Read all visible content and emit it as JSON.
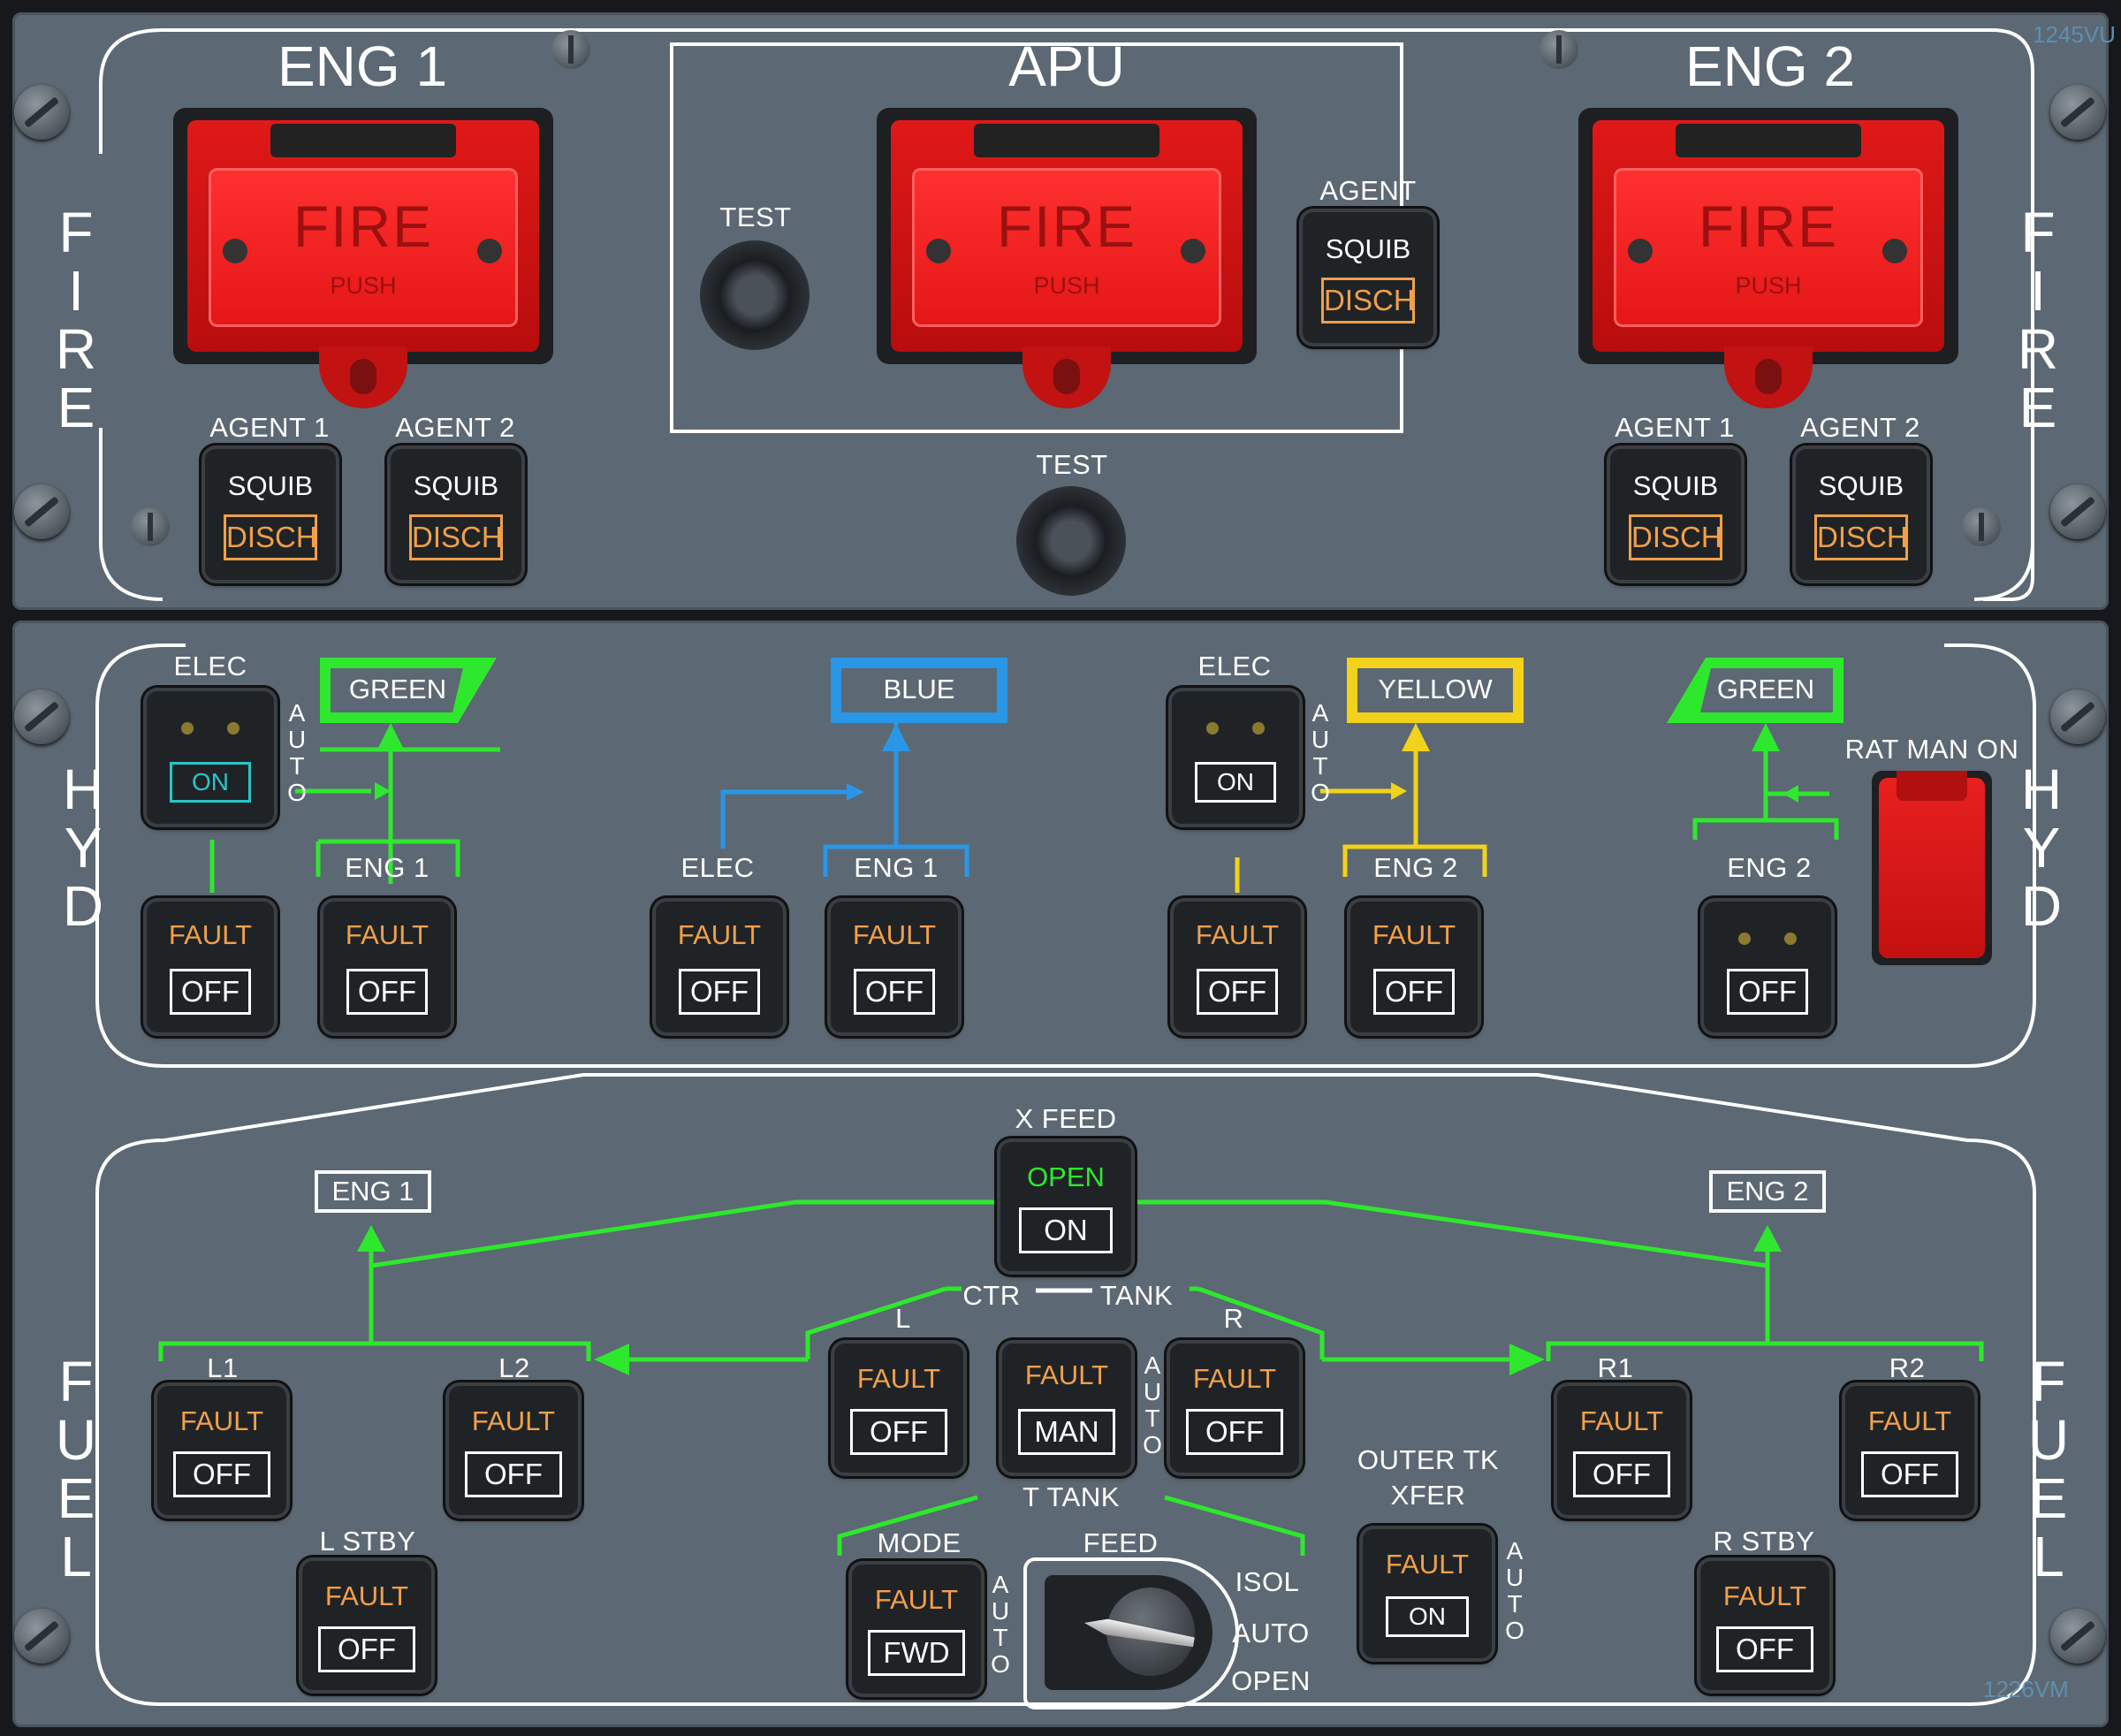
{
  "fire_panel": {
    "side_label": "FIRE",
    "eng1": {
      "title": "ENG 1",
      "fire_label": "FIRE",
      "push_label": "PUSH",
      "agent1": "AGENT 1",
      "agent2": "AGENT 2"
    },
    "apu": {
      "title": "APU",
      "fire_label": "FIRE",
      "push_label": "PUSH",
      "test_label": "TEST",
      "agent_label": "AGENT"
    },
    "eng2": {
      "title": "ENG 2",
      "fire_label": "FIRE",
      "push_label": "PUSH",
      "agent1": "AGENT 1",
      "agent2": "AGENT 2"
    },
    "test_label": "TEST",
    "squib": "SQUIB",
    "disch": "DISCH",
    "panel_id": "1245VU"
  },
  "hyd_panel": {
    "side_label": "HYD",
    "green": "GREEN",
    "blue": "BLUE",
    "yellow": "YELLOW",
    "elec": "ELEC",
    "on": "ON",
    "auto": "AUTO",
    "eng1": "ENG 1",
    "eng2": "ENG 2",
    "fault": "FAULT",
    "off": "OFF",
    "rat": "RAT MAN ON"
  },
  "fuel_panel": {
    "side_label": "FUEL",
    "xfeed": "X FEED",
    "open": "OPEN",
    "on": "ON",
    "eng1": "ENG 1",
    "eng2": "ENG 2",
    "ctr": "CTR",
    "tank": "TANK",
    "l": "L",
    "r": "R",
    "l1": "L1",
    "l2": "L2",
    "r1": "R1",
    "r2": "R2",
    "fault": "FAULT",
    "off": "OFF",
    "man": "MAN",
    "auto": "AUTO",
    "t_tank": "T TANK",
    "mode": "MODE",
    "fwd": "FWD",
    "feed": "FEED",
    "isol": "ISOL",
    "auto_pos": "AUTO",
    "open_pos": "OPEN",
    "outer_tk": "OUTER TK",
    "xfer": "XFER",
    "l_stby": "L STBY",
    "r_stby": "R STBY",
    "panel_id": "1226VM"
  },
  "colors": {
    "green": "#2ee82e",
    "blue": "#2a96e6",
    "yellow": "#f2d21a",
    "amber": "#f0a04a",
    "red": "#e01818",
    "panel": "#5c6873"
  }
}
